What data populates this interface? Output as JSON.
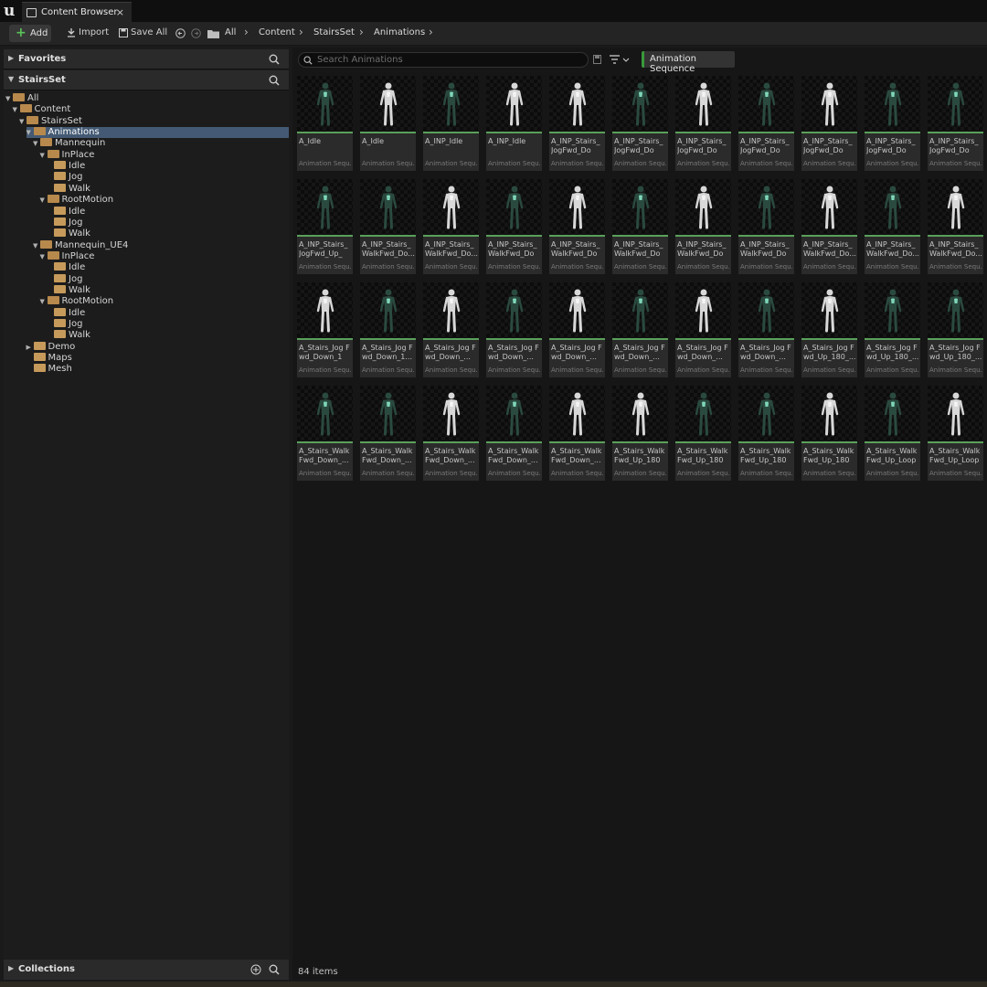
{
  "app": {
    "tab_title": "Content Browser",
    "tab_close": "×"
  },
  "toolbar": {
    "add_label": "Add",
    "import_label": "Import",
    "save_all_label": "Save All",
    "breadcrumbs": [
      "All",
      "Content",
      "StairsSet",
      "Animations"
    ]
  },
  "left": {
    "favorites_label": "Favorites",
    "stairsset_label": "StairsSet",
    "collections_label": "Collections",
    "tree": [
      {
        "label": "All",
        "depth": 0,
        "open": true
      },
      {
        "label": "Content",
        "depth": 1,
        "open": true
      },
      {
        "label": "StairsSet",
        "depth": 2,
        "open": true
      },
      {
        "label": "Animations",
        "depth": 3,
        "open": true,
        "selected": true
      },
      {
        "label": "Mannequin",
        "depth": 4,
        "open": true
      },
      {
        "label": "InPlace",
        "depth": 5,
        "open": true
      },
      {
        "label": "Idle",
        "depth": 6
      },
      {
        "label": "Jog",
        "depth": 6
      },
      {
        "label": "Walk",
        "depth": 6
      },
      {
        "label": "RootMotion",
        "depth": 5,
        "open": true
      },
      {
        "label": "Idle",
        "depth": 6
      },
      {
        "label": "Jog",
        "depth": 6
      },
      {
        "label": "Walk",
        "depth": 6
      },
      {
        "label": "Mannequin_UE4",
        "depth": 4,
        "open": true
      },
      {
        "label": "InPlace",
        "depth": 5,
        "open": true
      },
      {
        "label": "Idle",
        "depth": 6
      },
      {
        "label": "Jog",
        "depth": 6
      },
      {
        "label": "Walk",
        "depth": 6
      },
      {
        "label": "RootMotion",
        "depth": 5,
        "open": true
      },
      {
        "label": "Idle",
        "depth": 6
      },
      {
        "label": "Jog",
        "depth": 6
      },
      {
        "label": "Walk",
        "depth": 6
      },
      {
        "label": "Demo",
        "depth": 3,
        "collapsed": true
      },
      {
        "label": "Maps",
        "depth": 3
      },
      {
        "label": "Mesh",
        "depth": 3
      }
    ]
  },
  "main": {
    "search_placeholder": "Search Animations",
    "filter_chip": "Animation Sequence",
    "status": "84 items",
    "asset_type": "Animation Sequ...",
    "assets": [
      {
        "name": "A_Idle",
        "dark": true
      },
      {
        "name": "A_Idle",
        "dark": false
      },
      {
        "name": "A_INP_Idle",
        "dark": true
      },
      {
        "name": "A_INP_Idle",
        "dark": false
      },
      {
        "name": "A_INP_Stairs_ JogFwd_Do",
        "dark": false
      },
      {
        "name": "A_INP_Stairs_ JogFwd_Do",
        "dark": true
      },
      {
        "name": "A_INP_Stairs_ JogFwd_Do",
        "dark": false
      },
      {
        "name": "A_INP_Stairs_ JogFwd_Do",
        "dark": true
      },
      {
        "name": "A_INP_Stairs_ JogFwd_Do",
        "dark": false
      },
      {
        "name": "A_INP_Stairs_ JogFwd_Do",
        "dark": true
      },
      {
        "name": "A_INP_Stairs_ JogFwd_Do",
        "dark": true
      },
      {
        "name": "A_INP_Stairs_ JogFwd_Up_",
        "dark": true
      },
      {
        "name": "A_INP_Stairs_ WalkFwd_Do...",
        "dark": true
      },
      {
        "name": "A_INP_Stairs_ WalkFwd_Do...",
        "dark": false
      },
      {
        "name": "A_INP_Stairs_ WalkFwd_Do",
        "dark": true
      },
      {
        "name": "A_INP_Stairs_ WalkFwd_Do",
        "dark": false
      },
      {
        "name": "A_INP_Stairs_ WalkFwd_Do",
        "dark": true
      },
      {
        "name": "A_INP_Stairs_ WalkFwd_Do",
        "dark": false
      },
      {
        "name": "A_INP_Stairs_ WalkFwd_Do",
        "dark": true
      },
      {
        "name": "A_INP_Stairs_ WalkFwd_Do...",
        "dark": false
      },
      {
        "name": "A_INP_Stairs_ WalkFwd_Do...",
        "dark": true
      },
      {
        "name": "A_INP_Stairs_ WalkFwd_Do...",
        "dark": false
      },
      {
        "name": "A_Stairs_Jog Fwd_Down_1",
        "dark": false
      },
      {
        "name": "A_Stairs_Jog Fwd_Down_1...",
        "dark": true
      },
      {
        "name": "A_Stairs_Jog Fwd_Down_...",
        "dark": false
      },
      {
        "name": "A_Stairs_Jog Fwd_Down_...",
        "dark": true
      },
      {
        "name": "A_Stairs_Jog Fwd_Down_...",
        "dark": false
      },
      {
        "name": "A_Stairs_Jog Fwd_Down_...",
        "dark": true
      },
      {
        "name": "A_Stairs_Jog Fwd_Down_...",
        "dark": false
      },
      {
        "name": "A_Stairs_Jog Fwd_Down_...",
        "dark": true
      },
      {
        "name": "A_Stairs_Jog Fwd_Up_180_...",
        "dark": false
      },
      {
        "name": "A_Stairs_Jog Fwd_Up_180_...",
        "dark": true
      },
      {
        "name": "A_Stairs_Jog Fwd_Up_180_...",
        "dark": true
      },
      {
        "name": "A_Stairs_Walk Fwd_Down_...",
        "dark": true
      },
      {
        "name": "A_Stairs_Walk Fwd_Down_...",
        "dark": true
      },
      {
        "name": "A_Stairs_Walk Fwd_Down_...",
        "dark": false
      },
      {
        "name": "A_Stairs_Walk Fwd_Down_...",
        "dark": true
      },
      {
        "name": "A_Stairs_Walk Fwd_Down_...",
        "dark": false
      },
      {
        "name": "A_Stairs_Walk Fwd_Up_180_...",
        "dark": false
      },
      {
        "name": "A_Stairs_Walk Fwd_Up_180_...",
        "dark": true
      },
      {
        "name": "A_Stairs_Walk Fwd_Up_180_...",
        "dark": true
      },
      {
        "name": "A_Stairs_Walk Fwd_Up_180_...",
        "dark": false
      },
      {
        "name": "A_Stairs_Walk Fwd_Up_Loop",
        "dark": true
      },
      {
        "name": "A_Stairs_Walk Fwd_Up_Loop",
        "dark": false
      }
    ]
  },
  "colors": {
    "accent_green": "#5aa05a",
    "selection": "#445a74",
    "folder": "#c59a5a"
  }
}
